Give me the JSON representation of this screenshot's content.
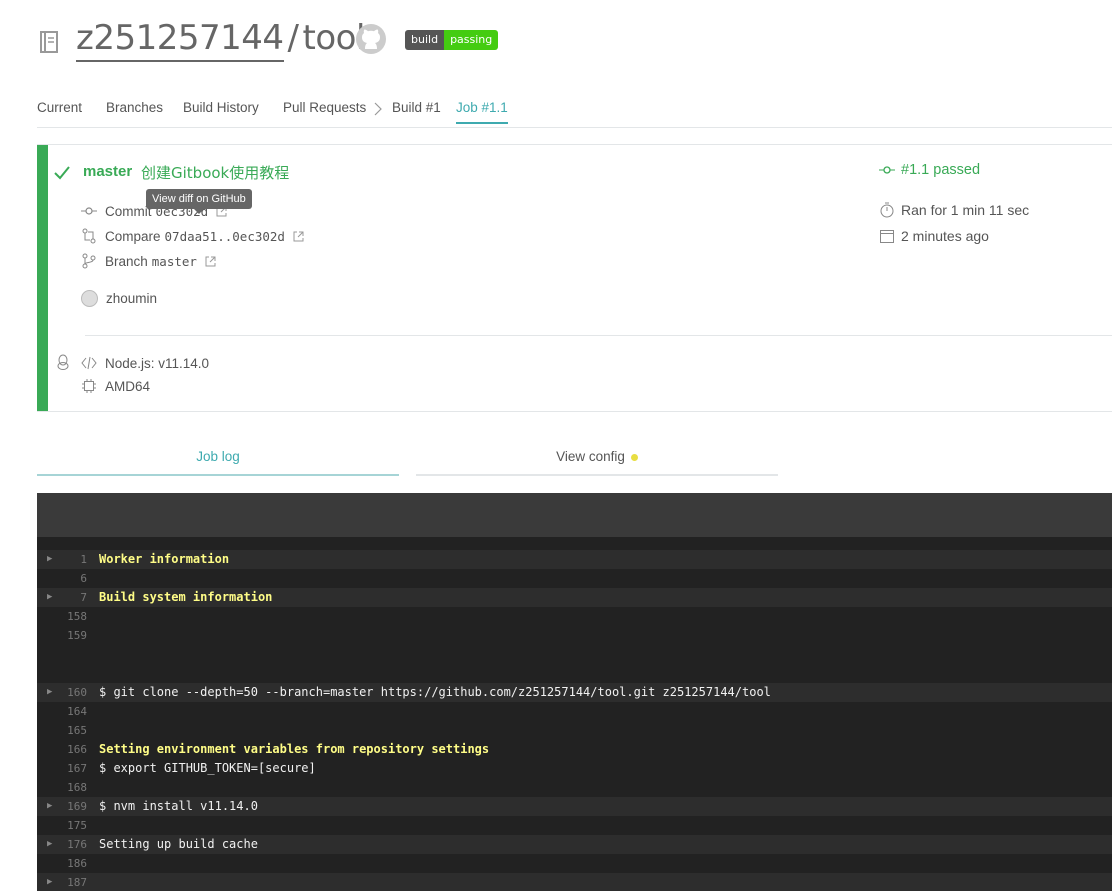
{
  "header": {
    "owner": "z251257144",
    "separator": "/",
    "repo": "tool",
    "badge_left": "build",
    "badge_right": "passing"
  },
  "nav": {
    "items": [
      "Current",
      "Branches",
      "Build History",
      "Pull Requests",
      "Build #1",
      "Job #1.1"
    ],
    "active": "Job #1.1"
  },
  "summary": {
    "branch": "master",
    "commit_message": "创建Gitbook使用教程",
    "tooltip": "View diff on GitHub",
    "commit_label": "Commit",
    "commit_hash": "0ec302d",
    "compare_label": "Compare",
    "compare_range": "07daa51..0ec302d",
    "branch_label": "Branch",
    "branch_value": "master",
    "author": "zhoumin",
    "job_status": "#1.1 passed",
    "duration": "Ran for 1 min 11 sec",
    "finished": "2 minutes ago",
    "language": "Node.js: v11.14.0",
    "arch": "AMD64",
    "colors": {
      "passed": "#39aa56",
      "accent": "#3eaaaf"
    }
  },
  "log_tabs": {
    "job_log": "Job log",
    "view_config": "View config"
  },
  "log": {
    "lines": [
      {
        "num": "1",
        "text": "Worker information",
        "style": "yellow",
        "fold": true
      },
      {
        "num": "6",
        "text": "",
        "style": "",
        "fold": false
      },
      {
        "num": "7",
        "text": "Build system information",
        "style": "yellow",
        "fold": true
      },
      {
        "num": "158",
        "text": "",
        "style": "",
        "fold": false
      },
      {
        "num": "159",
        "text": "",
        "style": "",
        "fold": false
      },
      {
        "num": "160",
        "text": "$ git clone --depth=50 --branch=master https://github.com/z251257144/tool.git z251257144/tool",
        "style": "",
        "fold": true
      },
      {
        "num": "164",
        "text": "",
        "style": "",
        "fold": false
      },
      {
        "num": "165",
        "text": "",
        "style": "",
        "fold": false
      },
      {
        "num": "166",
        "text": "Setting environment variables from repository settings",
        "style": "yellow",
        "fold": false
      },
      {
        "num": "167",
        "text": "$ export GITHUB_TOKEN=[secure]",
        "style": "",
        "fold": false
      },
      {
        "num": "168",
        "text": "",
        "style": "",
        "fold": false
      },
      {
        "num": "169",
        "text": "$ nvm install v11.14.0",
        "style": "",
        "fold": true
      },
      {
        "num": "175",
        "text": "",
        "style": "",
        "fold": false
      },
      {
        "num": "176",
        "text": "Setting up build cache",
        "style": "",
        "fold": true
      },
      {
        "num": "186",
        "text": "",
        "style": "",
        "fold": false
      },
      {
        "num": "187",
        "text": "",
        "style": "",
        "fold": true
      }
    ]
  }
}
